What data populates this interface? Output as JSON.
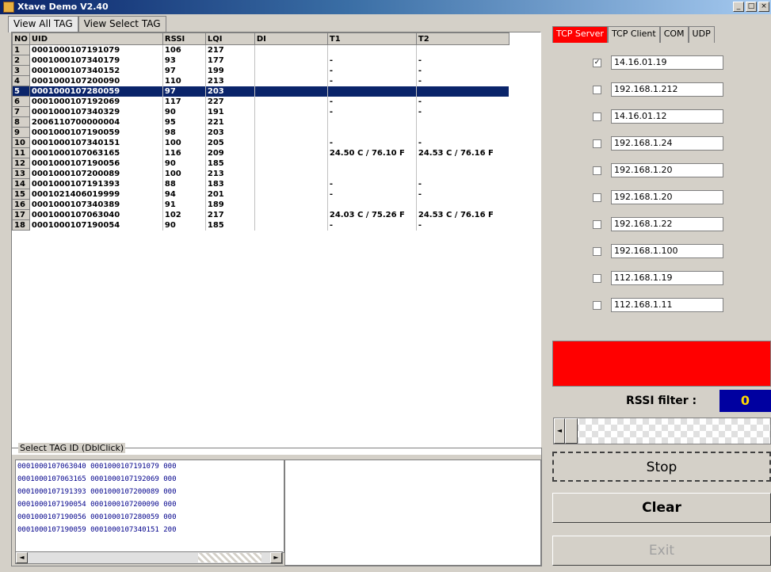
{
  "window": {
    "title": "Xtave Demo V2.40",
    "min_label": "_",
    "max_label": "□",
    "close_label": "×"
  },
  "left_tabs": [
    {
      "label": "View All TAG",
      "active": true
    },
    {
      "label": "View Select TAG",
      "active": false
    }
  ],
  "grid": {
    "headers": {
      "no": "NO",
      "uid": "UID",
      "rssi": "RSSI",
      "lqi": "LQI",
      "di": "DI",
      "t1": "T1",
      "t2": "T2"
    },
    "selected_row": 5,
    "rows": [
      {
        "no": "1",
        "uid": "0001000107191079",
        "rssi": "106",
        "lqi": "217",
        "di": "",
        "t1": "",
        "t2": ""
      },
      {
        "no": "2",
        "uid": "0001000107340179",
        "rssi": "93",
        "lqi": "177",
        "di": "",
        "t1": "-",
        "t2": "-"
      },
      {
        "no": "3",
        "uid": "0001000107340152",
        "rssi": "97",
        "lqi": "199",
        "di": "",
        "t1": "-",
        "t2": "-"
      },
      {
        "no": "4",
        "uid": "0001000107200090",
        "rssi": "110",
        "lqi": "213",
        "di": "",
        "t1": "-",
        "t2": "-"
      },
      {
        "no": "5",
        "uid": "0001000107280059",
        "rssi": "97",
        "lqi": "203",
        "di": "",
        "t1": "",
        "t2": ""
      },
      {
        "no": "6",
        "uid": "0001000107192069",
        "rssi": "117",
        "lqi": "227",
        "di": "",
        "t1": "-",
        "t2": "-"
      },
      {
        "no": "7",
        "uid": "0001000107340329",
        "rssi": "90",
        "lqi": "191",
        "di": "",
        "t1": "-",
        "t2": "-"
      },
      {
        "no": "8",
        "uid": "2006110700000004",
        "rssi": "95",
        "lqi": "221",
        "di": "",
        "t1": "",
        "t2": ""
      },
      {
        "no": "9",
        "uid": "0001000107190059",
        "rssi": "98",
        "lqi": "203",
        "di": "",
        "t1": "",
        "t2": ""
      },
      {
        "no": "10",
        "uid": "0001000107340151",
        "rssi": "100",
        "lqi": "205",
        "di": "",
        "t1": "-",
        "t2": "-"
      },
      {
        "no": "11",
        "uid": "0001000107063165",
        "rssi": "116",
        "lqi": "209",
        "di": "",
        "t1": "24.50 C / 76.10 F",
        "t2": "24.53 C / 76.16 F"
      },
      {
        "no": "12",
        "uid": "0001000107190056",
        "rssi": "90",
        "lqi": "185",
        "di": "",
        "t1": "",
        "t2": ""
      },
      {
        "no": "13",
        "uid": "0001000107200089",
        "rssi": "100",
        "lqi": "213",
        "di": "",
        "t1": "",
        "t2": ""
      },
      {
        "no": "14",
        "uid": "0001000107191393",
        "rssi": "88",
        "lqi": "183",
        "di": "",
        "t1": "-",
        "t2": "-"
      },
      {
        "no": "15",
        "uid": "0001021406019999",
        "rssi": "94",
        "lqi": "201",
        "di": "",
        "t1": "-",
        "t2": "-"
      },
      {
        "no": "16",
        "uid": "0001000107340389",
        "rssi": "91",
        "lqi": "189",
        "di": "",
        "t1": "",
        "t2": ""
      },
      {
        "no": "17",
        "uid": "0001000107063040",
        "rssi": "102",
        "lqi": "217",
        "di": "",
        "t1": "24.03 C / 75.26 F",
        "t2": "24.53 C / 76.16 F"
      },
      {
        "no": "18",
        "uid": "0001000107190054",
        "rssi": "90",
        "lqi": "185",
        "di": "",
        "t1": "-",
        "t2": "-"
      }
    ]
  },
  "select_group": {
    "legend": "Select TAG ID (DblClick)",
    "rows": [
      "0001000107063040  0001000107191079  000",
      "0001000107063165  0001000107192069  000",
      "0001000107191393  0001000107200089  000",
      "0001000107190054  0001000107200090  000",
      "0001000107190056  0001000107280059  000",
      "0001000107190059  0001000107340151  200"
    ],
    "scroll_left": "◄",
    "scroll_right": "►"
  },
  "right_tabs": [
    {
      "label": "TCP Server",
      "active": true
    },
    {
      "label": "TCP Client",
      "active": false
    },
    {
      "label": "COM",
      "active": false
    },
    {
      "label": "UDP",
      "active": false
    }
  ],
  "ip_list": [
    {
      "checked": true,
      "value": "14.16.01.19"
    },
    {
      "checked": false,
      "value": "192.168.1.212"
    },
    {
      "checked": false,
      "value": "14.16.01.12"
    },
    {
      "checked": false,
      "value": "192.168.1.24"
    },
    {
      "checked": false,
      "value": "192.168.1.20"
    },
    {
      "checked": false,
      "value": "192.168.1.20"
    },
    {
      "checked": false,
      "value": "192.168.1.22"
    },
    {
      "checked": false,
      "value": "192.168.1.100"
    },
    {
      "checked": false,
      "value": "112.168.1.19"
    },
    {
      "checked": false,
      "value": "112.168.1.11"
    }
  ],
  "colors": {
    "status_panel": "#ff0000",
    "rssi_bg": "#0000a0",
    "rssi_fg": "#ffd800",
    "selection": "#0a246a"
  },
  "rssi": {
    "label": "RSSI filter :",
    "value": "0"
  },
  "slider": {
    "left_arrow": "◄",
    "right_arrow": "►",
    "value_fraction": 0
  },
  "buttons": {
    "stop": "Stop",
    "clear": "Clear",
    "exit": "Exit"
  }
}
